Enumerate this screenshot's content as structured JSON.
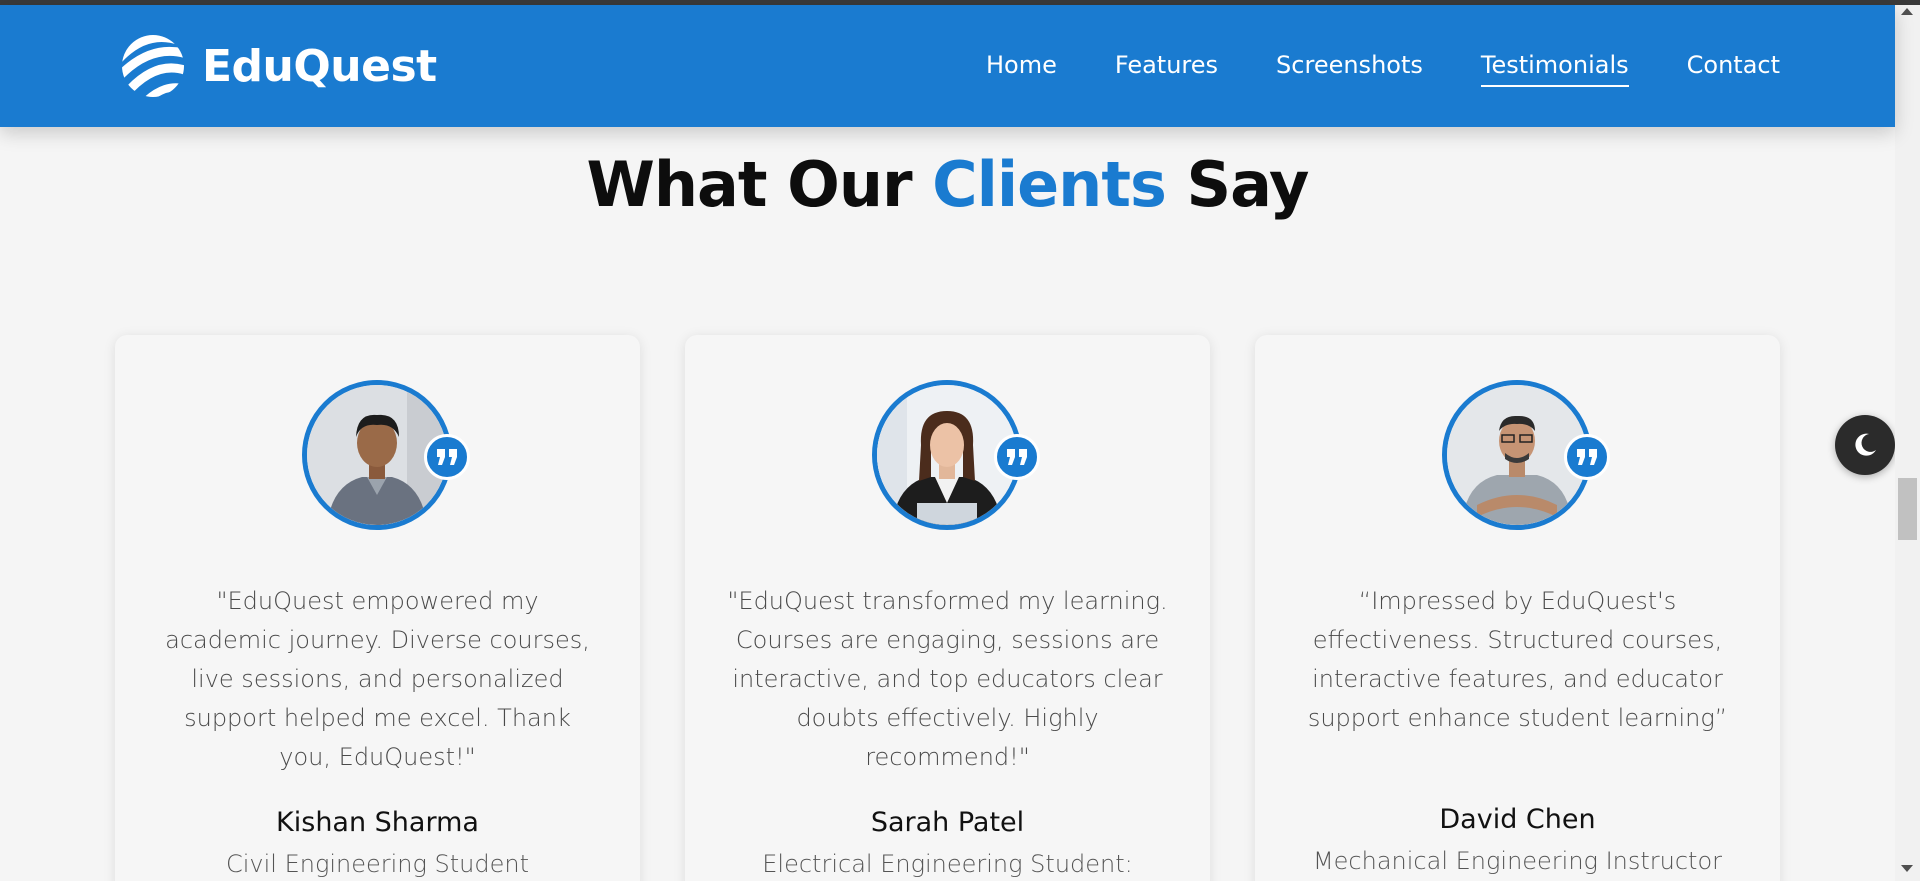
{
  "brand": {
    "name": "EduQuest",
    "logo_icon": "striped-sphere-logo"
  },
  "nav": {
    "items": [
      {
        "label": "Home",
        "active": false
      },
      {
        "label": "Features",
        "active": false
      },
      {
        "label": "Screenshots",
        "active": false
      },
      {
        "label": "Testimonials",
        "active": true
      },
      {
        "label": "Contact",
        "active": false
      }
    ]
  },
  "section": {
    "heading_before": "What Our ",
    "heading_accent": "Clients",
    "heading_after": " Say"
  },
  "testimonials": [
    {
      "quote": "\"EduQuest empowered my academic journey. Diverse courses, live sessions, and personalized support helped me excel. Thank you, EduQuest!\"",
      "name": "Kishan Sharma",
      "role": "Civil Engineering Student",
      "avatar_icon": "person-photo"
    },
    {
      "quote": "\"EduQuest transformed my learning. Courses are engaging, sessions are interactive, and top educators clear doubts effectively. Highly recommend!\"",
      "name": "Sarah Patel",
      "role": "Electrical Engineering Student:",
      "avatar_icon": "person-photo"
    },
    {
      "quote": "“Impressed by EduQuest's effectiveness. Structured courses, interactive features, and educator support enhance student learning”",
      "name": "David Chen",
      "role": "Mechanical Engineering Instructor",
      "avatar_icon": "person-photo"
    }
  ],
  "theme_toggle": {
    "icon": "moon-icon"
  },
  "colors": {
    "brand": "#1a7bd0",
    "background": "#f5f5f5",
    "heading": "#0d0d0d"
  }
}
